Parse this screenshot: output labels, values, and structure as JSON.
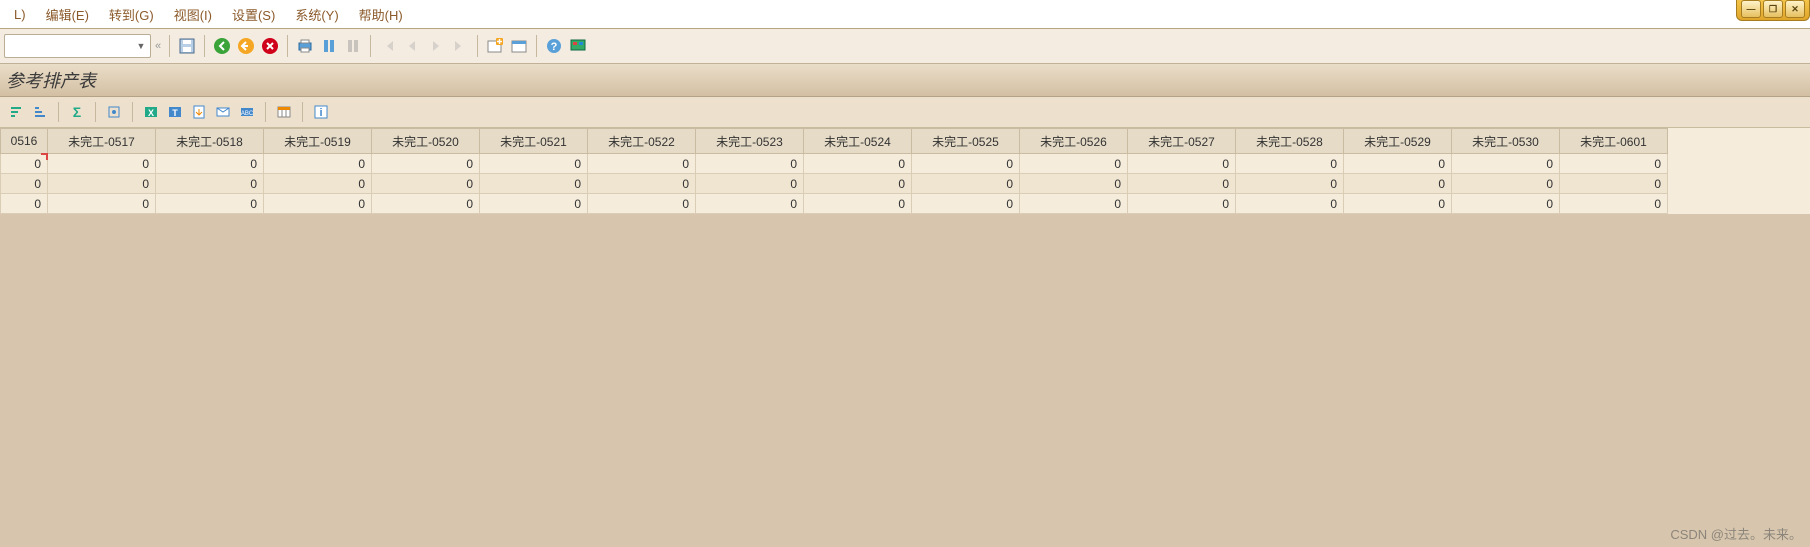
{
  "menu": {
    "items": [
      "L)",
      "编辑(E)",
      "转到(G)",
      "视图(I)",
      "设置(S)",
      "系统(Y)",
      "帮助(H)"
    ]
  },
  "title": "参考排产表",
  "combo_value": "",
  "table": {
    "headers": [
      "0516",
      "未完工-0517",
      "未完工-0518",
      "未完工-0519",
      "未完工-0520",
      "未完工-0521",
      "未完工-0522",
      "未完工-0523",
      "未完工-0524",
      "未完工-0525",
      "未完工-0526",
      "未完工-0527",
      "未完工-0528",
      "未完工-0529",
      "未完工-0530",
      "未完工-0601"
    ],
    "rows": [
      [
        0,
        0,
        0,
        0,
        0,
        0,
        0,
        0,
        0,
        0,
        0,
        0,
        0,
        0,
        0,
        0
      ],
      [
        0,
        0,
        0,
        0,
        0,
        0,
        0,
        0,
        0,
        0,
        0,
        0,
        0,
        0,
        0,
        0
      ],
      [
        0,
        0,
        0,
        0,
        0,
        0,
        0,
        0,
        0,
        0,
        0,
        0,
        0,
        0,
        0,
        0
      ]
    ]
  },
  "watermark": "CSDN @过去。未来。"
}
